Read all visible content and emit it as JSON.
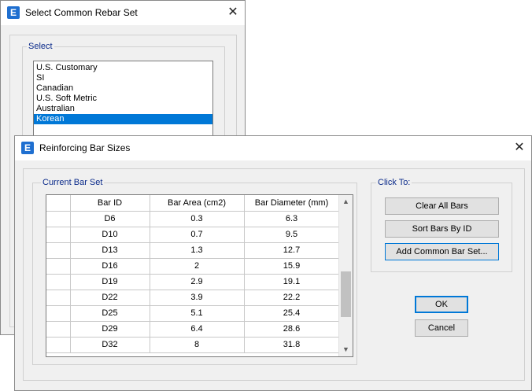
{
  "rebar_dialog": {
    "icon": "E",
    "title": "Select Common Rebar Set",
    "group_label": "Select",
    "options": [
      "U.S. Customary",
      "SI",
      "Canadian",
      "U.S. Soft Metric",
      "Australian",
      "Korean"
    ],
    "selected": "Korean"
  },
  "bar_dialog": {
    "icon": "E",
    "title": "Reinforcing Bar Sizes",
    "current_group_label": "Current Bar Set",
    "click_group_label": "Click To:",
    "columns": [
      "Bar ID",
      "Bar Area  (cm2)",
      "Bar Diameter  (mm)"
    ],
    "rows": [
      [
        "D6",
        "0.3",
        "6.3"
      ],
      [
        "D10",
        "0.7",
        "9.5"
      ],
      [
        "D13",
        "1.3",
        "12.7"
      ],
      [
        "D16",
        "2",
        "15.9"
      ],
      [
        "D19",
        "2.9",
        "19.1"
      ],
      [
        "D22",
        "3.9",
        "22.2"
      ],
      [
        "D25",
        "5.1",
        "25.4"
      ],
      [
        "D29",
        "6.4",
        "28.6"
      ],
      [
        "D32",
        "8",
        "31.8"
      ]
    ],
    "buttons": {
      "clear": "Clear All Bars",
      "sort": "Sort Bars By ID",
      "add": "Add Common Bar Set...",
      "ok": "OK",
      "cancel": "Cancel"
    }
  },
  "icons": {
    "close": "close-icon",
    "app": "app-icon",
    "scroll_up": "chevron-up-icon",
    "scroll_down": "chevron-down-icon"
  }
}
